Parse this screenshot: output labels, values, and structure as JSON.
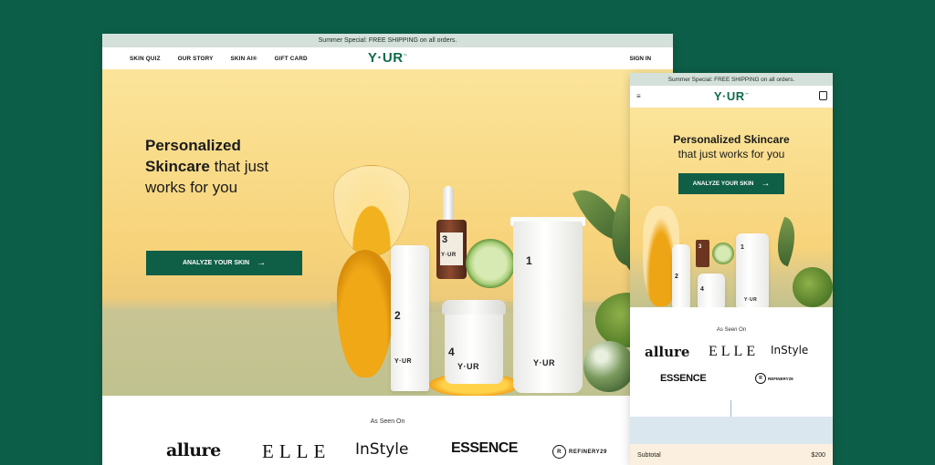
{
  "desktop": {
    "banner": "Summer Special: FREE SHIPPING on all orders.",
    "nav": [
      "SKIN QUIZ",
      "OUR STORY",
      "SKIN AI®",
      "GIFT CARD"
    ],
    "logo": "Y·UR",
    "logo_tm": "™",
    "signin": "SIGN IN",
    "hero": {
      "title_bold_1": "Personalized",
      "title_bold_2": "Skincare",
      "title_rest_1": " that just",
      "title_rest_2": "works for you",
      "cta": "ANALYZE YOUR SKIN",
      "cta_arrow": "→"
    },
    "products": {
      "n1": "1",
      "n2": "2",
      "n3": "3",
      "n4": "4",
      "mini_logo": "Y·UR"
    },
    "seen_on": {
      "label": "As Seen On",
      "brands": [
        "allure",
        "ELLE",
        "InStyle",
        "ESSENCE",
        "REFINERY29"
      ],
      "r29_mark": "R"
    }
  },
  "mobile": {
    "banner": "Summer Special: FREE SHIPPING on all orders.",
    "menu_icon": "≡",
    "logo": "Y·UR",
    "logo_tm": "™",
    "hero": {
      "title_bold": "Personalized Skincare",
      "title_rest": "that just works for you",
      "cta": "ANALYZE YOUR SKIN",
      "cta_arrow": "→"
    },
    "products": {
      "n1": "1",
      "n2": "2",
      "n3": "3",
      "n4": "4",
      "mini_logo": "Y·UR"
    },
    "seen_on": {
      "label": "As Seen On",
      "brands": [
        "allure",
        "ELLE",
        "InStyle",
        "ESSENCE",
        "REFINERY29"
      ],
      "r29_mark": "R"
    },
    "down_arrow": "▼",
    "subtotal_label": "Subtotal",
    "subtotal_value": "$200"
  },
  "colors": {
    "background": "#0d5e48",
    "brand_green": "#0f5e46",
    "banner": "#d4e1da",
    "hero_yellow": "#f7d37a"
  }
}
